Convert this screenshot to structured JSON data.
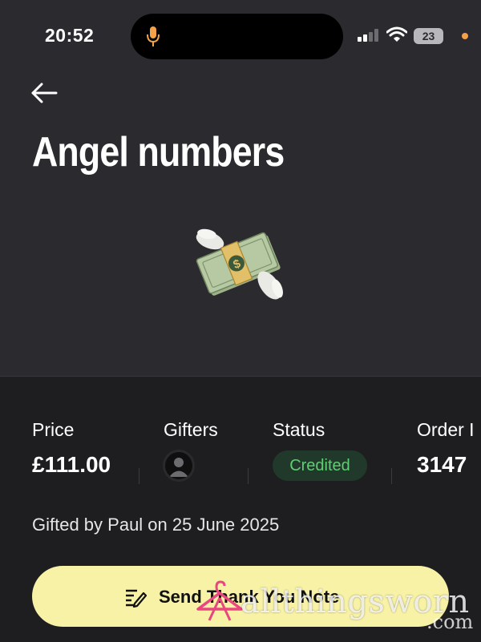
{
  "status_bar": {
    "time": "20:52",
    "battery": "23",
    "icons": [
      "microphone-icon",
      "cellular-signal-icon",
      "wifi-icon",
      "battery-icon"
    ],
    "accent_colors": {
      "mic": "#f5a14a",
      "privacy_dot": "#f5a14a"
    }
  },
  "header": {
    "back_icon": "back-arrow-icon",
    "title": "Angel numbers",
    "gift_icon": "money-with-wings-emoji"
  },
  "details": {
    "price": {
      "label": "Price",
      "value": "£111.00"
    },
    "gifters": {
      "label": "Gifters",
      "avatar_icon": "default-avatar-icon"
    },
    "status": {
      "label": "Status",
      "value": "Credited",
      "color": "#5fcf72"
    },
    "order_id": {
      "label": "Order I",
      "value": "3147"
    }
  },
  "gifted_note": "Gifted by Paul on 25 June 2025",
  "cta": {
    "label": "Send Thank You Note",
    "icon": "write-note-icon",
    "background": "#f8f2a7"
  },
  "watermark": {
    "text": "allthingsworn",
    "suffix": ".com",
    "icon": "hanger-icon",
    "color": "#e8477f"
  }
}
